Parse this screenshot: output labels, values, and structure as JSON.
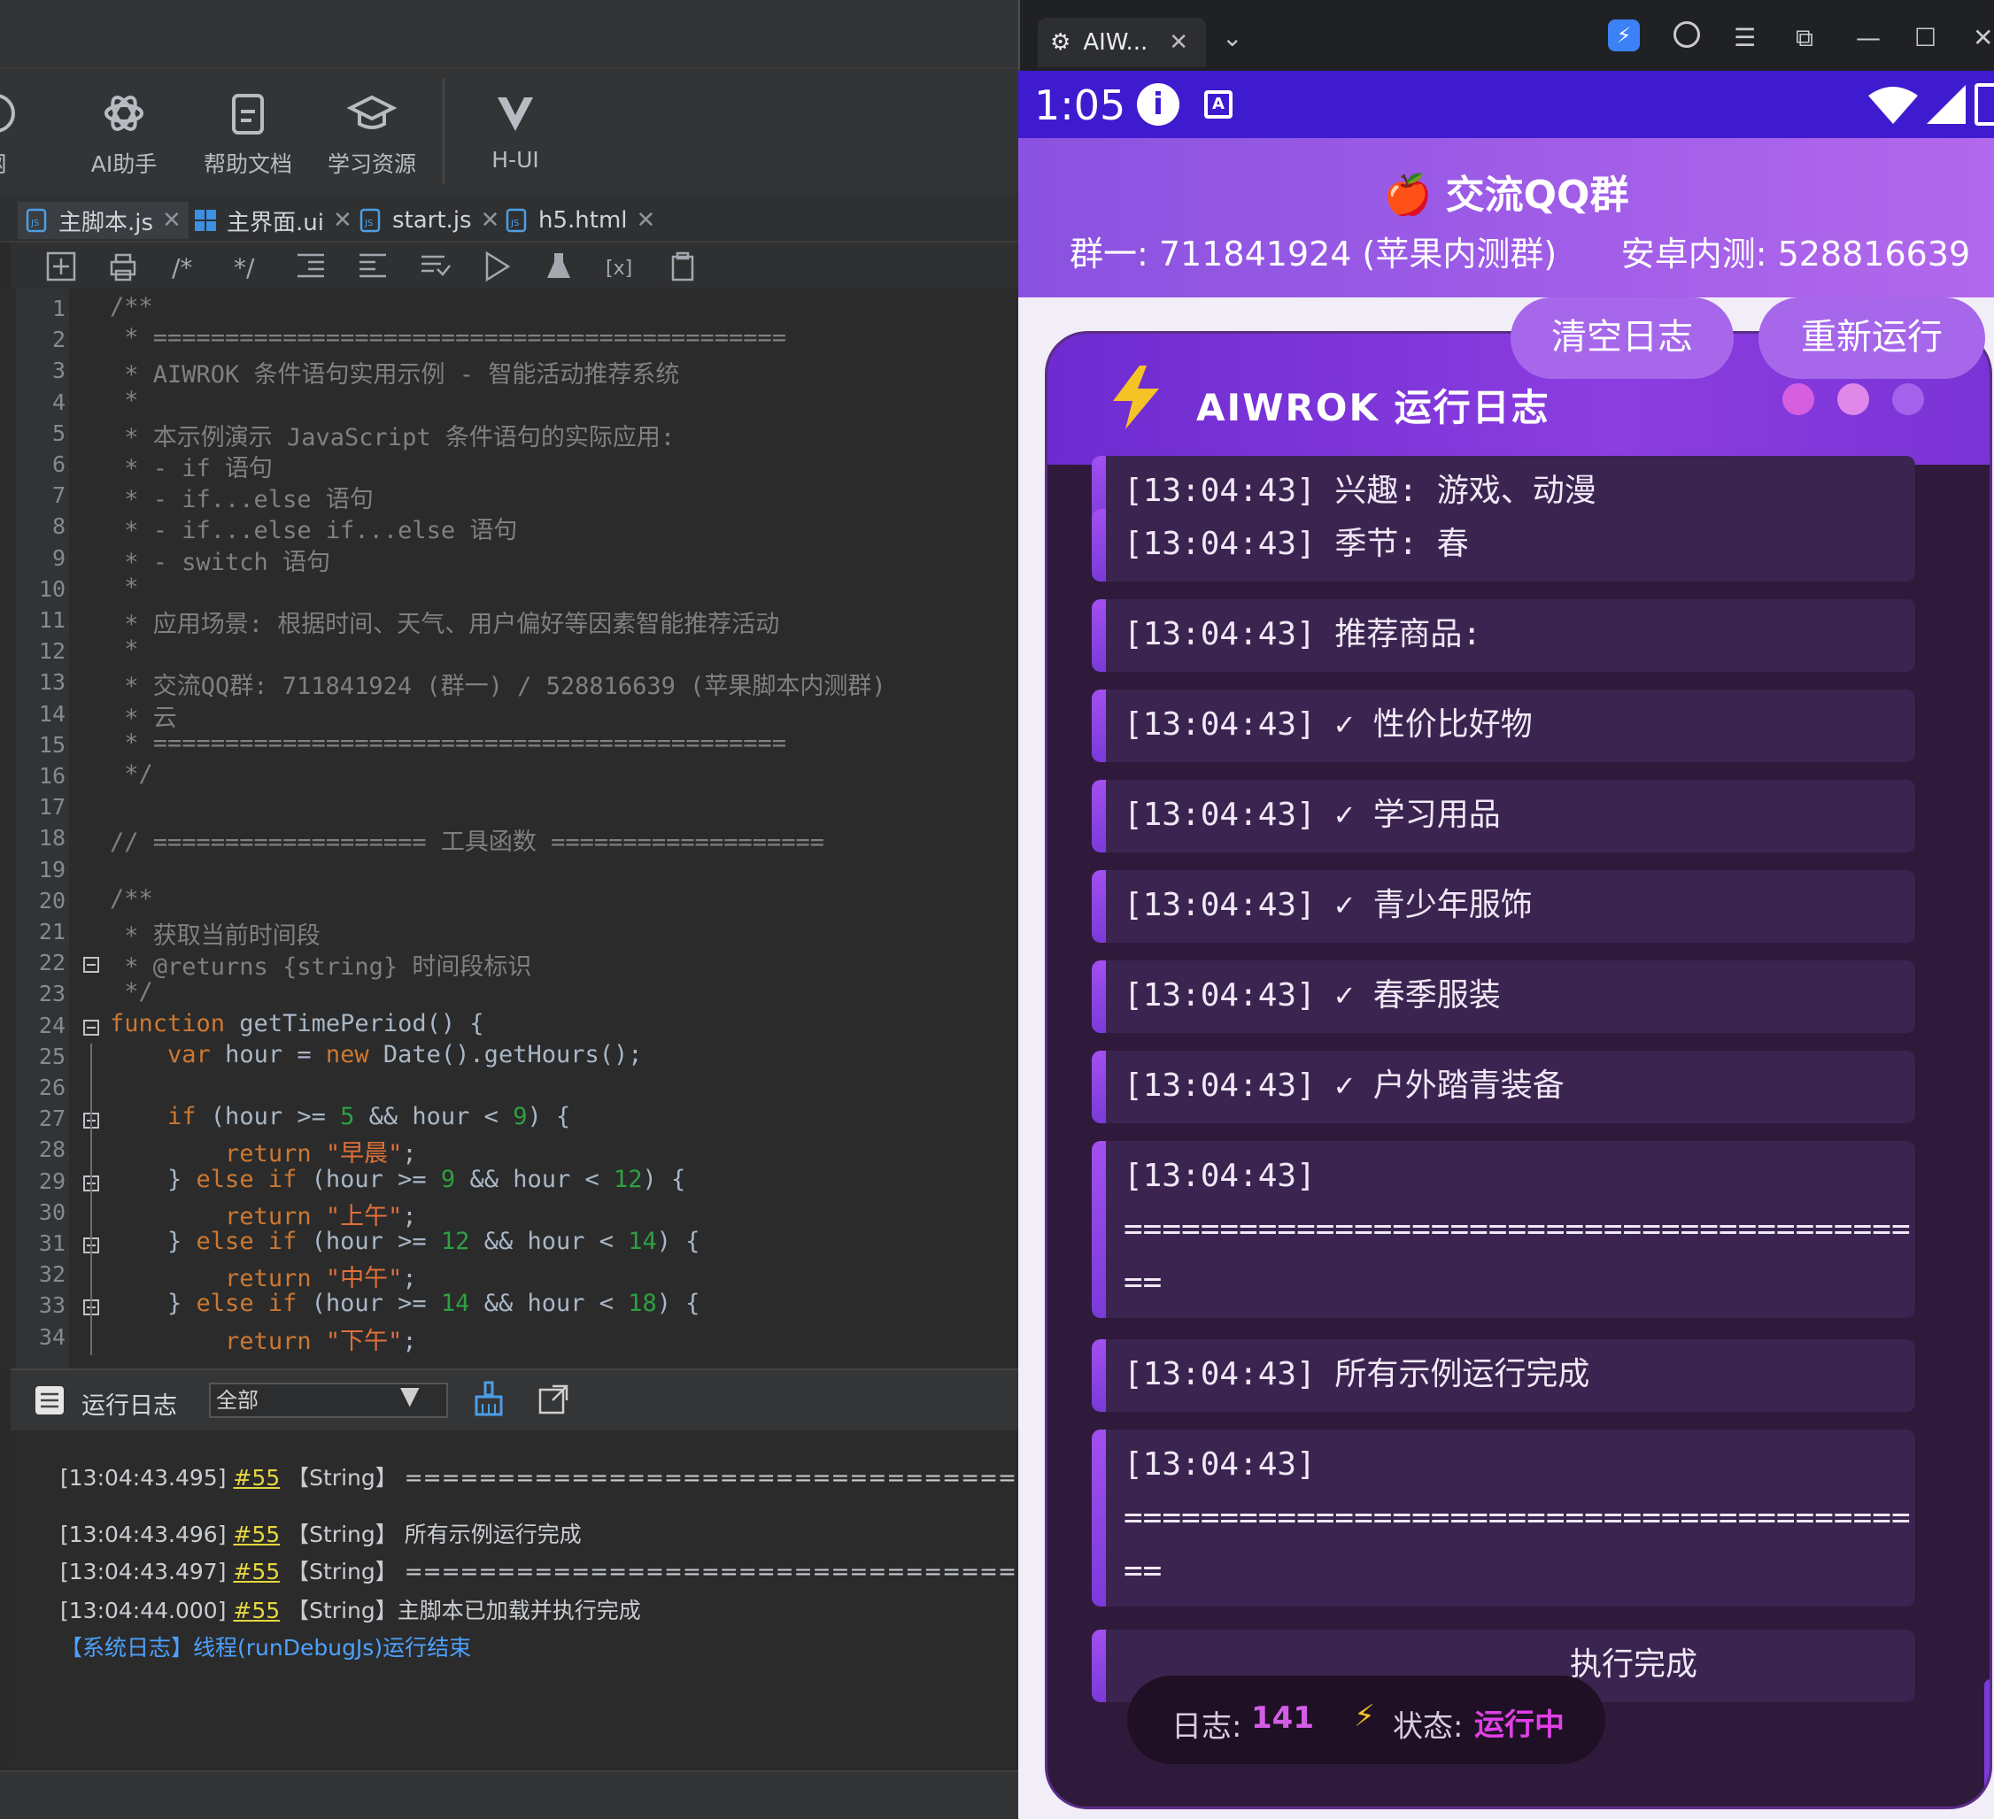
{
  "ide": {
    "toolbar": [
      {
        "label": "网",
        "icon": "help-circle-icon"
      },
      {
        "label": "AI助手",
        "icon": "ai-assistant-icon"
      },
      {
        "label": "帮助文档",
        "icon": "document-icon"
      },
      {
        "label": "学习资源",
        "icon": "graduation-cap-icon"
      },
      {
        "label": "H-UI",
        "icon": "h-ui-logo-icon"
      }
    ],
    "tabs": [
      {
        "label": "主脚本.js",
        "icon": "js-file-icon"
      },
      {
        "label": "主界面.ui",
        "icon": "ui-file-icon"
      },
      {
        "label": "start.js",
        "icon": "js-file-icon"
      },
      {
        "label": "h5.html",
        "icon": "js-file-icon"
      }
    ],
    "code_lines": [
      "/**",
      " * ============================================",
      " * AIWROK 条件语句实用示例 - 智能活动推荐系统",
      " *",
      " * 本示例演示 JavaScript 条件语句的实际应用:",
      " * - if 语句",
      " * - if...else 语句",
      " * - if...else if...else 语句",
      " * - switch 语句",
      " *",
      " * 应用场景: 根据时间、天气、用户偏好等因素智能推荐活动",
      " *",
      " * 交流QQ群: 711841924 (群一) / 528816639 (苹果脚本内测群)",
      " * 云",
      " * ============================================",
      " */",
      "",
      "// =================== 工具函数 ===================",
      "",
      "/**",
      " * 获取当前时间段",
      " * @returns {string} 时间段标识",
      " */",
      "function getTimePeriod() {",
      "    var hour = new Date().getHours();",
      "",
      "    if (hour >= 5 && hour < 9) {",
      "        return \"早晨\";",
      "    } else if (hour >= 9 && hour < 12) {",
      "        return \"上午\";",
      "    } else if (hour >= 12 && hour < 14) {",
      "        return \"中午\";",
      "    } else if (hour >= 14 && hour < 18) {",
      "        return \"下午\";"
    ],
    "log_panel": {
      "title": "运行日志",
      "filter": "全部"
    },
    "log_lines": [
      {
        "ts": "[13:04:43.495]",
        "ref": "#55",
        "type": "【String】",
        "msg": " ========================================"
      },
      {
        "ts": "[13:04:43.496]",
        "ref": "#55",
        "type": "【String】",
        "msg": " 所有示例运行完成"
      },
      {
        "ts": "[13:04:43.497]",
        "ref": "#55",
        "type": "【String】",
        "msg": " ========================================"
      },
      {
        "ts": "[13:04:44.000]",
        "ref": "#55",
        "type": "【String】",
        "msg": "主脚本已加载并执行完成"
      }
    ],
    "sys_log": "【系统日志】线程(runDebugJs)运行结束"
  },
  "phone": {
    "window_tab": "AIW...",
    "status_time": "1:05",
    "header_title": "🍎 交流QQ群",
    "group1": "群一: 711841924 (苹果内测群)",
    "group2": "安卓内测: 528816639",
    "clear_btn": "清空日志",
    "rerun_btn": "重新运行",
    "panel_title": "AIWROK 运行日志",
    "entries": [
      "[13:04:43] 兴趣: 游戏、动漫",
      "[13:04:43] 季节: 春",
      "[13:04:43] 推荐商品:",
      "[13:04:43] ✓ 性价比好物",
      "[13:04:43] ✓ 学习用品",
      "[13:04:43] ✓ 青少年服饰",
      "[13:04:43] ✓ 春季服装",
      "[13:04:43] ✓ 户外踏青装备",
      "[13:04:43]\n=========================================\n==",
      "[13:04:43] 所有示例运行完成",
      "[13:04:43]\n=========================================\n==",
      "执行完成"
    ],
    "stat_log_label": "日志:",
    "stat_log_count": "141",
    "stat_state_label": "状态:",
    "stat_state_value": "运行中",
    "colors": {
      "accent": "#8a52e0",
      "status_bar": "#3f1bcf",
      "panel": "#2f1a3b"
    }
  }
}
